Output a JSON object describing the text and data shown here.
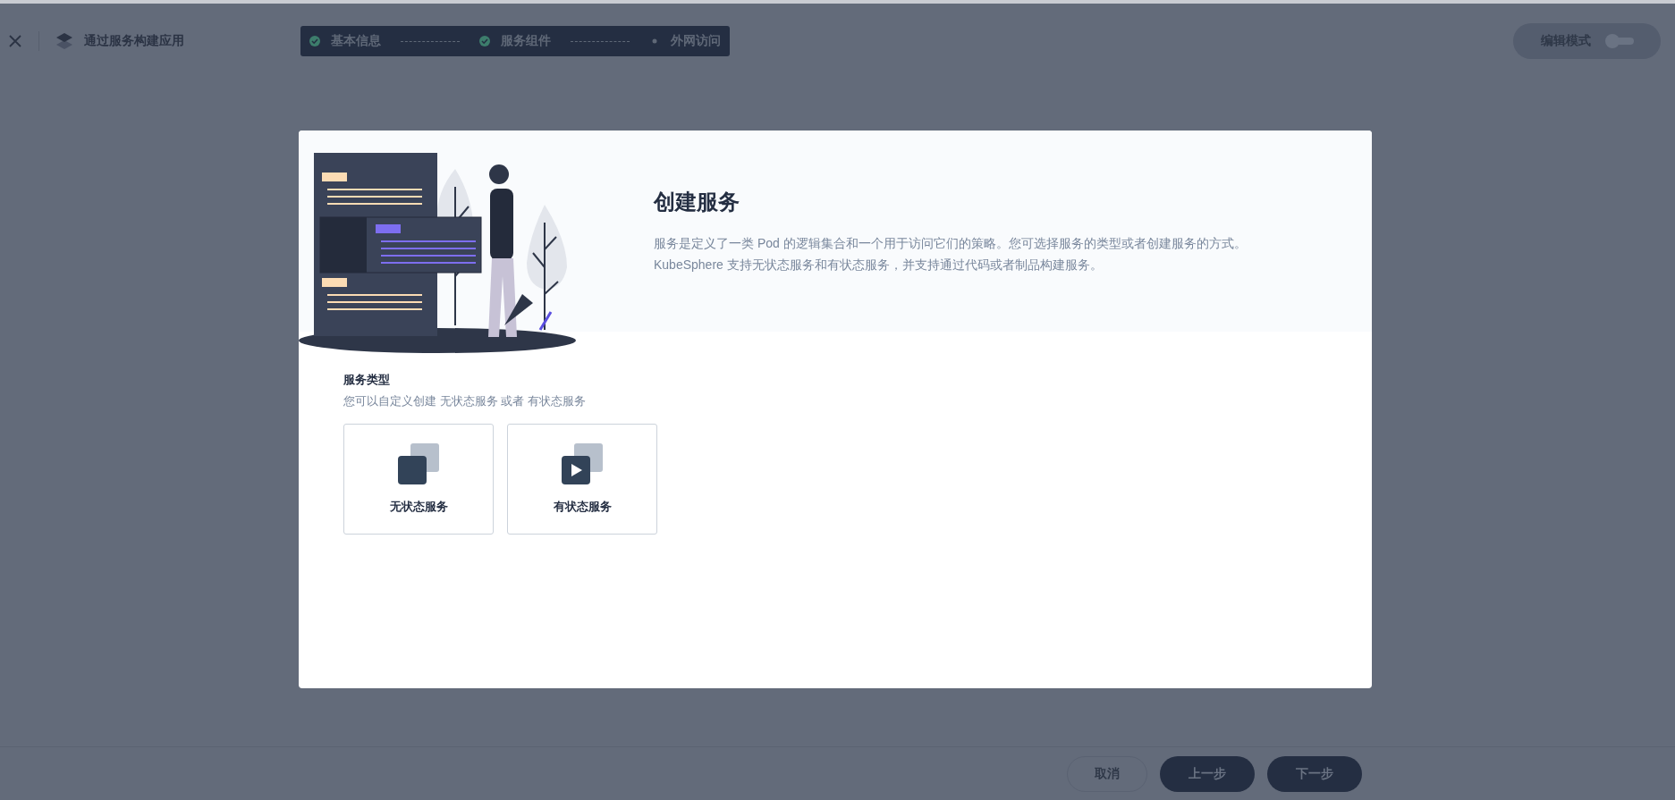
{
  "header": {
    "title": "通过服务构建应用"
  },
  "steps": [
    {
      "label": "基本信息",
      "done": true
    },
    {
      "label": "服务组件",
      "done": true
    },
    {
      "label": "外网访问",
      "done": false
    }
  ],
  "edit_mode": {
    "label": "编辑模式",
    "on": false
  },
  "dialog": {
    "title": "创建服务",
    "description": [
      "服务是定义了一类 Pod 的逻辑集合和一个用于访问它们的策略。您可选择服务的类型或者创建服务的方式。",
      "KubeSphere 支持无状态服务和有状态服务，并支持通过代码或者制品构建服务。"
    ],
    "section": {
      "label": "服务类型",
      "hint": "您可以自定义创建 无状态服务 或者 有状态服务"
    },
    "service_types": [
      {
        "label": "无状态服务",
        "kind": "stateless"
      },
      {
        "label": "有状态服务",
        "kind": "stateful"
      }
    ]
  },
  "footer": {
    "buttons": [
      {
        "label": "取消",
        "kind": "secondary"
      },
      {
        "label": "上一步",
        "kind": "primary"
      },
      {
        "label": "下一步",
        "kind": "primary"
      }
    ]
  }
}
